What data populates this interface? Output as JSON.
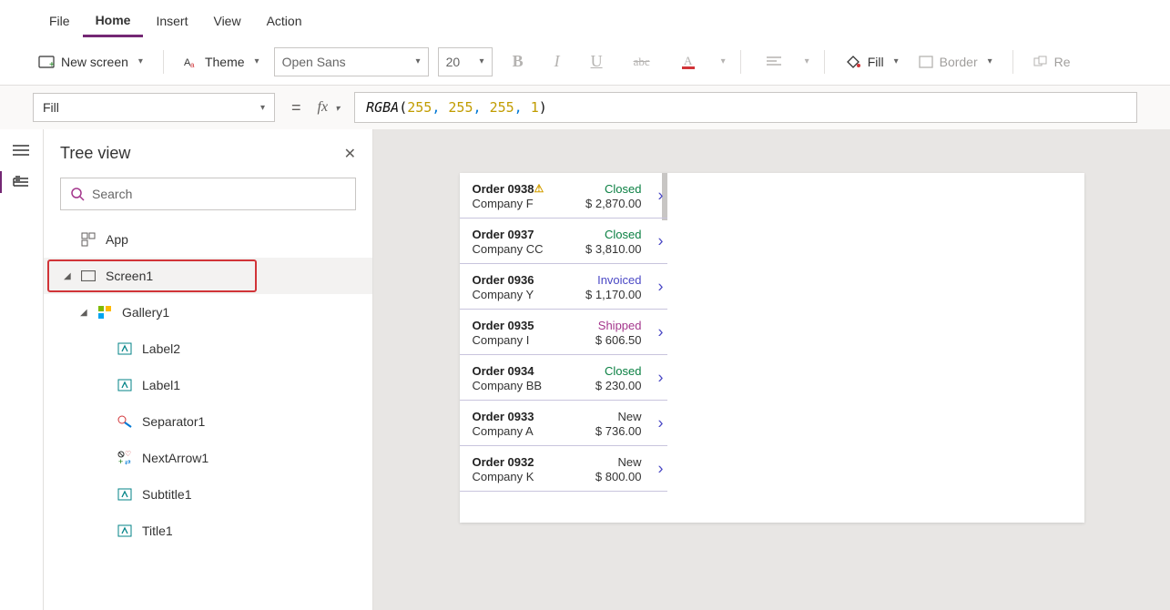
{
  "menu": {
    "file": "File",
    "home": "Home",
    "insert": "Insert",
    "view": "View",
    "action": "Action"
  },
  "toolbar": {
    "new_screen": "New screen",
    "theme": "Theme",
    "font_name": "Open Sans",
    "font_size": "20",
    "fill": "Fill",
    "border": "Border",
    "reorder": "Re"
  },
  "formula": {
    "property": "Fill",
    "fx": "fx",
    "fn": "RGBA",
    "a1": "255",
    "a2": "255",
    "a3": "255",
    "a4": "1"
  },
  "tree": {
    "title": "Tree view",
    "search_placeholder": "Search",
    "app": "App",
    "screen1": "Screen1",
    "gallery1": "Gallery1",
    "label2": "Label2",
    "label1": "Label1",
    "separator1": "Separator1",
    "nextarrow1": "NextArrow1",
    "subtitle1": "Subtitle1",
    "title1": "Title1"
  },
  "gallery": [
    {
      "order": "Order 0938",
      "warn": true,
      "status": "Closed",
      "scls": "g",
      "company": "Company F",
      "amount": "$ 2,870.00"
    },
    {
      "order": "Order 0937",
      "warn": false,
      "status": "Closed",
      "scls": "g",
      "company": "Company CC",
      "amount": "$ 3,810.00"
    },
    {
      "order": "Order 0936",
      "warn": false,
      "status": "Invoiced",
      "scls": "b",
      "company": "Company Y",
      "amount": "$ 1,170.00"
    },
    {
      "order": "Order 0935",
      "warn": false,
      "status": "Shipped",
      "scls": "p",
      "company": "Company I",
      "amount": "$ 606.50"
    },
    {
      "order": "Order 0934",
      "warn": false,
      "status": "Closed",
      "scls": "g",
      "company": "Company BB",
      "amount": "$ 230.00"
    },
    {
      "order": "Order 0933",
      "warn": false,
      "status": "New",
      "scls": "k",
      "company": "Company A",
      "amount": "$ 736.00"
    },
    {
      "order": "Order 0932",
      "warn": false,
      "status": "New",
      "scls": "k",
      "company": "Company K",
      "amount": "$ 800.00"
    }
  ]
}
